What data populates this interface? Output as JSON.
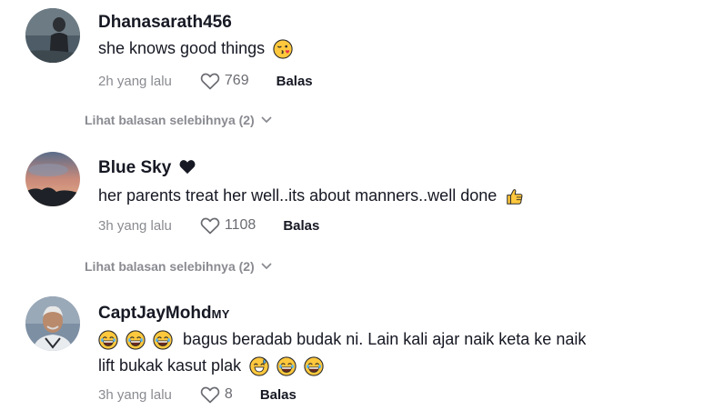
{
  "comments": [
    {
      "username": "Dhanasarath456",
      "text": "she knows good things",
      "emoji": "face-blowing-kiss",
      "time": "2h yang lalu",
      "likes": "769",
      "reply_label": "Balas",
      "view_more": "Lihat balasan selebihnya (2)"
    },
    {
      "username": "Blue Sky",
      "username_suffix_icon": "black-heart",
      "text": "her parents treat her well..its about manners..well done",
      "emoji": "thumbs-up",
      "time": "3h yang lalu",
      "likes": "1108",
      "reply_label": "Balas",
      "view_more": "Lihat balasan selebihnya (2)"
    },
    {
      "username": "CaptJayMohd",
      "username_badge": "MY",
      "text_line1": "bagus beradab budak ni. Lain kali ajar naik keta ke naik",
      "text_line2": "lift bukak kasut plak",
      "emoji_line1": [
        "joy",
        "joy",
        "joy"
      ],
      "emoji_line2": [
        "grinning-sweat",
        "joy",
        "joy"
      ],
      "time": "3h yang lalu",
      "likes": "8",
      "reply_label": "Balas"
    }
  ],
  "colors": {
    "text": "#161823",
    "muted": "#8a8b91",
    "emoji_yellow": "#FFC83D"
  }
}
